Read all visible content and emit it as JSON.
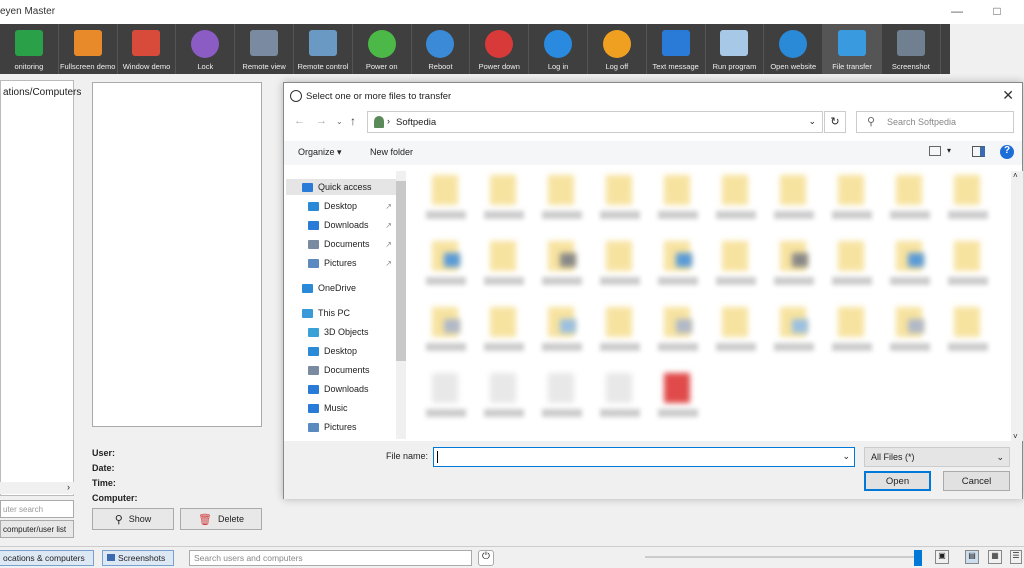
{
  "window": {
    "title": "eyen Master"
  },
  "toolbar": {
    "items": [
      {
        "label": "onitoring",
        "icon": "monitoring-icon",
        "color": "#2aa048"
      },
      {
        "label": "Fullscreen demo",
        "icon": "fullscreen-demo-icon",
        "color": "#e8892a"
      },
      {
        "label": "Window demo",
        "icon": "window-demo-icon",
        "color": "#d84a3a"
      },
      {
        "label": "Lock",
        "icon": "lock-icon",
        "color": "#8a5cc4"
      },
      {
        "label": "Remote view",
        "icon": "remote-view-icon",
        "color": "#7a8aa0"
      },
      {
        "label": "Remote control",
        "icon": "remote-control-icon",
        "color": "#6a9ac4"
      },
      {
        "label": "Power on",
        "icon": "power-on-icon",
        "color": "#4cb848"
      },
      {
        "label": "Reboot",
        "icon": "reboot-icon",
        "color": "#3a8ad8"
      },
      {
        "label": "Power down",
        "icon": "power-down-icon",
        "color": "#d83a3a"
      },
      {
        "label": "Log in",
        "icon": "log-in-icon",
        "color": "#2a8ae0"
      },
      {
        "label": "Log off",
        "icon": "log-off-icon",
        "color": "#f0a020"
      },
      {
        "label": "Text message",
        "icon": "text-message-icon",
        "color": "#2a7ad8"
      },
      {
        "label": "Run program",
        "icon": "run-program-icon",
        "color": "#a8c8e8"
      },
      {
        "label": "Open website",
        "icon": "open-website-icon",
        "color": "#2a8ad8"
      },
      {
        "label": "File transfer",
        "icon": "file-transfer-icon",
        "color": "#3a9ae0"
      },
      {
        "label": "Screenshot",
        "icon": "screenshot-icon",
        "color": "#708090"
      }
    ]
  },
  "left": {
    "header": "ations/Computers",
    "search_placeholder": "uter search",
    "list_button": "computer/user list"
  },
  "details": {
    "user": "User:",
    "date": "Date:",
    "time": "Time:",
    "computer": "Computer:",
    "show": "Show",
    "delete": "Delete"
  },
  "status": {
    "tab_locations": "ocations & computers",
    "tab_screenshots": "Screenshots",
    "search_placeholder": "Search users and computers"
  },
  "dialog": {
    "title": "Select one or more files to transfer",
    "path": "Softpedia",
    "search_placeholder": "Search Softpedia",
    "organize": "Organize",
    "new_folder": "New folder",
    "nav": [
      {
        "label": "Quick access",
        "icon": "quick-access-icon"
      },
      {
        "label": "Desktop",
        "icon": "desktop-icon"
      },
      {
        "label": "Downloads",
        "icon": "downloads-icon"
      },
      {
        "label": "Documents",
        "icon": "documents-icon"
      },
      {
        "label": "Pictures",
        "icon": "pictures-icon"
      },
      {
        "label": "OneDrive",
        "icon": "onedrive-icon"
      },
      {
        "label": "This PC",
        "icon": "this-pc-icon"
      },
      {
        "label": "3D Objects",
        "icon": "3d-objects-icon"
      },
      {
        "label": "Desktop",
        "icon": "desktop-icon"
      },
      {
        "label": "Documents",
        "icon": "documents-icon"
      },
      {
        "label": "Downloads",
        "icon": "downloads-icon"
      },
      {
        "label": "Music",
        "icon": "music-icon"
      },
      {
        "label": "Pictures",
        "icon": "pictures-icon"
      }
    ],
    "file_name_label": "File name:",
    "file_name_value": "",
    "filter": "All Files  (*)",
    "open": "Open",
    "cancel": "Cancel"
  }
}
